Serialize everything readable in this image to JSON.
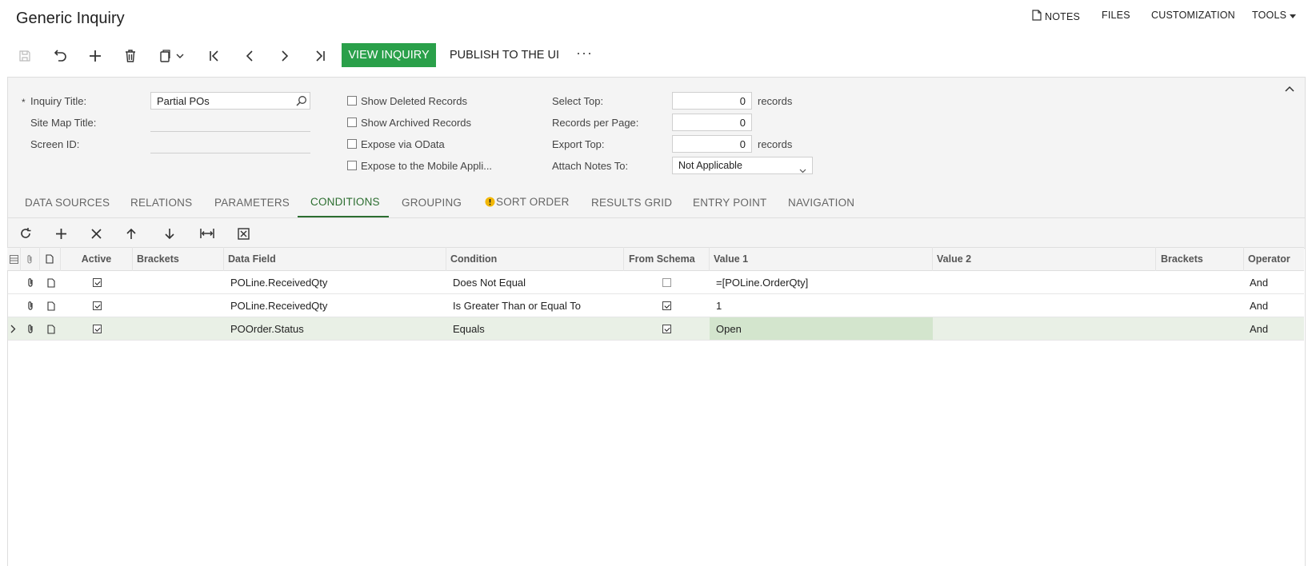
{
  "page_title": "Generic Inquiry",
  "top_menu": {
    "notes": "NOTES",
    "files": "FILES",
    "customization": "CUSTOMIZATION",
    "tools": "TOOLS"
  },
  "toolbar": {
    "view_inquiry": "VIEW INQUIRY",
    "publish": "PUBLISH TO THE UI",
    "more": "···"
  },
  "form": {
    "inquiry_title_label": "Inquiry Title:",
    "inquiry_title_value": "Partial POs",
    "site_map_title_label": "Site Map Title:",
    "screen_id_label": "Screen ID:",
    "show_deleted_label": "Show Deleted Records",
    "show_archived_label": "Show Archived Records",
    "expose_odata_label": "Expose via OData",
    "expose_mobile_label": "Expose to the Mobile Appli...",
    "select_top_label": "Select Top:",
    "select_top_value": "0",
    "records_per_page_label": "Records per Page:",
    "records_per_page_value": "0",
    "export_top_label": "Export Top:",
    "export_top_value": "0",
    "records_suffix": "records",
    "attach_notes_label": "Attach Notes To:",
    "attach_notes_value": "Not Applicable"
  },
  "tabs": [
    "DATA SOURCES",
    "RELATIONS",
    "PARAMETERS",
    "CONDITIONS",
    "GROUPING",
    "SORT ORDER",
    "RESULTS GRID",
    "ENTRY POINT",
    "NAVIGATION"
  ],
  "active_tab": "CONDITIONS",
  "grid": {
    "headers": {
      "active": "Active",
      "brackets_open": "Brackets",
      "data_field": "Data Field",
      "condition": "Condition",
      "from_schema": "From Schema",
      "value1": "Value 1",
      "value2": "Value 2",
      "brackets_close": "Brackets",
      "operator": "Operator"
    },
    "rows": [
      {
        "active": true,
        "data_field": "POLine.ReceivedQty",
        "condition": "Does Not Equal",
        "from_schema": false,
        "value1": "=[POLine.OrderQty]",
        "value2": "",
        "operator": "And"
      },
      {
        "active": true,
        "data_field": "POLine.ReceivedQty",
        "condition": "Is Greater Than or Equal To",
        "from_schema": true,
        "value1": "1",
        "value2": "",
        "operator": "And"
      },
      {
        "active": true,
        "data_field": "POOrder.Status",
        "condition": "Equals",
        "from_schema": true,
        "value1": "Open",
        "value2": "",
        "operator": "And",
        "selected": true
      }
    ]
  },
  "colors": {
    "accent_green": "#2aa04a",
    "tab_active": "#2c6e30",
    "selected_row": "#e9f0e6"
  }
}
